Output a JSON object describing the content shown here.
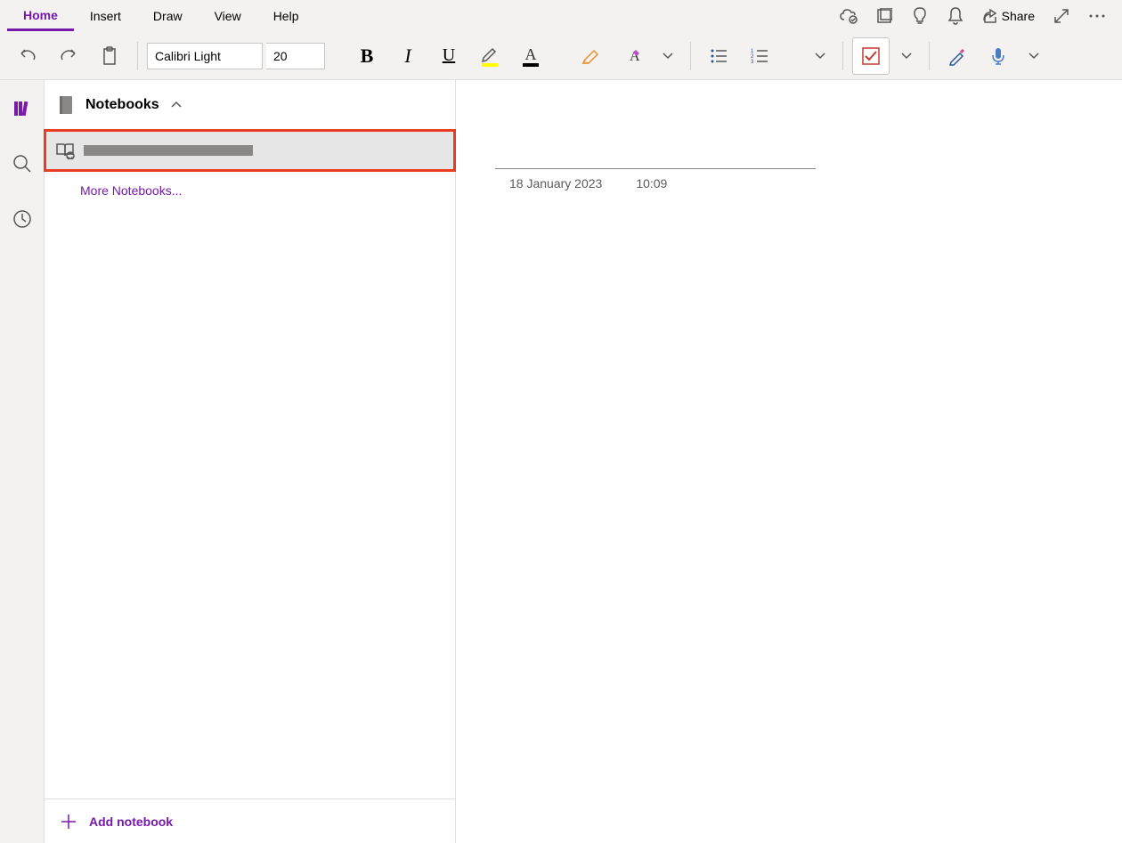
{
  "tabs": {
    "home": "Home",
    "insert": "Insert",
    "draw": "Draw",
    "view": "View",
    "help": "Help"
  },
  "titlebar": {
    "share": "Share"
  },
  "ribbon": {
    "font_name": "Calibri Light",
    "font_size": "20"
  },
  "panel": {
    "header_title": "Notebooks",
    "more_notebooks": "More Notebooks...",
    "add_notebook": "Add notebook"
  },
  "page": {
    "title": "",
    "date": "18 January 2023",
    "time": "10:09"
  }
}
